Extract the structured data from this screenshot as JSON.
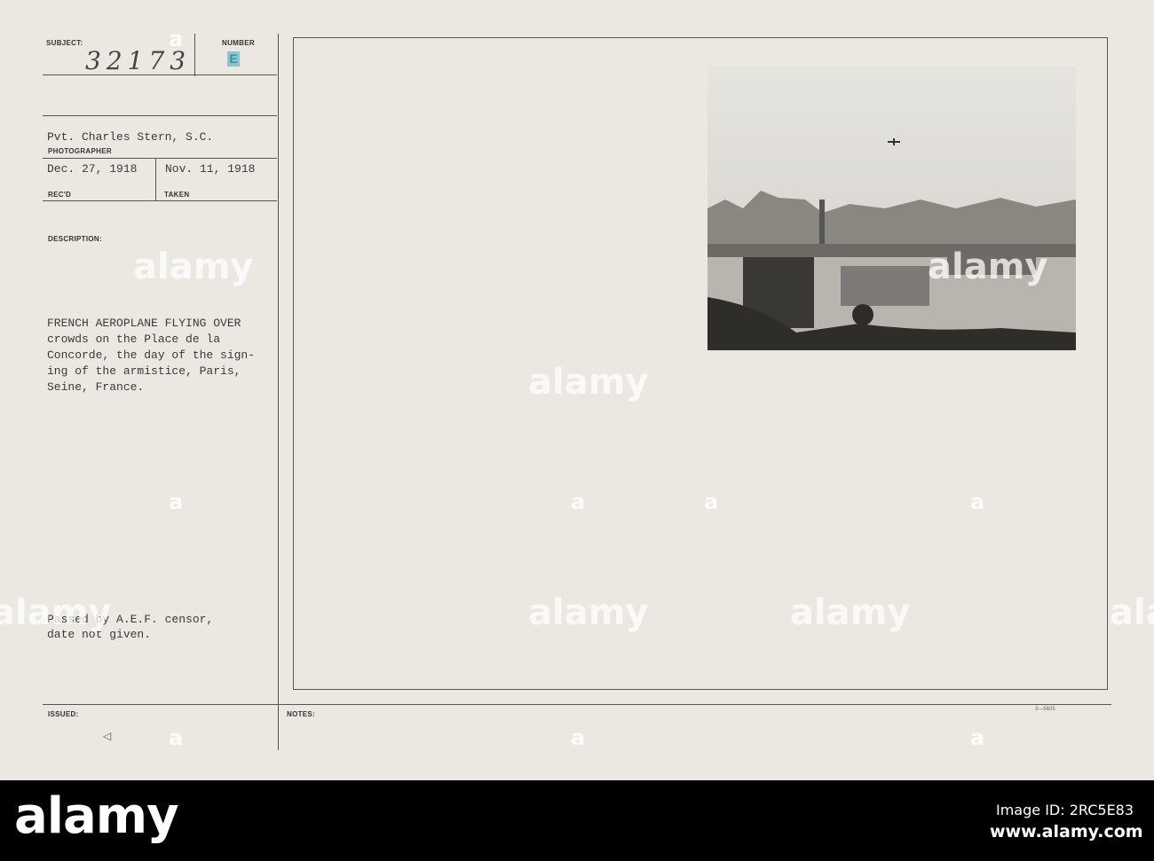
{
  "card": {
    "subject_label": "SUBJECT:",
    "subject_number": "32173",
    "number_label": "NUMBER",
    "number_stamp": "E",
    "photographer": "Pvt. Charles Stern, S.C.",
    "photographer_label": "PHOTOGRAPHER",
    "received": "Dec. 27, 1918",
    "received_label": "REC'D",
    "taken": "Nov. 11, 1918",
    "taken_label": "TAKEN",
    "description_label": "DESCRIPTION:",
    "description_lines": [
      "FRENCH AEROPLANE FLYING OVER",
      "crowds on the Place de la",
      "Concorde, the day of the sign-",
      "ing of the armistice, Paris,",
      "Seine, France."
    ],
    "censor_lines": [
      "Passed by A.E.F. censor,",
      "date not given."
    ],
    "issued_label": "ISSUED:",
    "issued_mark": "◁",
    "notes_label": "NOTES:",
    "form_number": "3—5605"
  },
  "watermark": {
    "text": "alamy",
    "letter": "a"
  },
  "footer": {
    "logo": "alamy",
    "image_id": "Image ID: 2RC5E83",
    "url": "www.alamy.com"
  }
}
